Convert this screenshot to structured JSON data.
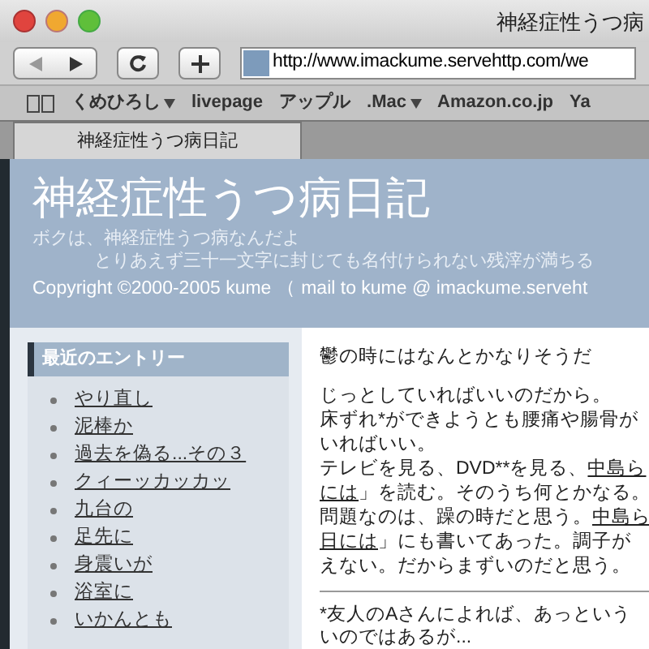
{
  "window": {
    "title": "神経症性うつ病"
  },
  "toolbar": {
    "url": "http://www.imackume.servehttp.com/we"
  },
  "bookmarks": [
    {
      "label": "くめひろし",
      "has_menu": true
    },
    {
      "label": "livepage",
      "has_menu": false
    },
    {
      "label": "アップル",
      "has_menu": false
    },
    {
      "label": ".Mac",
      "has_menu": true
    },
    {
      "label": "Amazon.co.jp",
      "has_menu": false
    },
    {
      "label": "Ya",
      "has_menu": false
    }
  ],
  "tabs": [
    {
      "label": "神経症性うつ病日記",
      "selected": true
    }
  ],
  "header": {
    "title": "神経症性うつ病日記",
    "tagline": [
      "ボクは、神経症性うつ病なんだよ",
      "とりあえず三十一文字に封じても名付けられない残滓が満ちる"
    ],
    "copyright": "Copyright ©2000-2005 kume （ mail to kume @ imackume.serveht"
  },
  "sidebar": {
    "heading": "最近のエントリー",
    "entries": [
      "やり直し",
      "泥棒か",
      "過去を偽る...その３",
      "クィーッカッカッ",
      "九台の",
      "足先に",
      "身震いが",
      "浴室に",
      "いかんとも"
    ]
  },
  "article": {
    "heading": "鬱の時にはなんとかなりそうだ",
    "lines": [
      [
        {
          "text": "じっとしていればいいのだから。",
          "link": false
        }
      ],
      [
        {
          "text": "床ずれ*ができようとも腰痛や腸骨が",
          "link": false
        }
      ],
      [
        {
          "text": "いればいい。",
          "link": false
        }
      ],
      [
        {
          "text": "テレビを見る、DVD**を見る、",
          "link": false
        },
        {
          "text": "中島ら",
          "link": true
        }
      ],
      [
        {
          "text": "には",
          "link": true
        },
        {
          "text": "」を読む。そのうち何とかなる。",
          "link": false
        }
      ],
      [
        {
          "text": "問題なのは、躁の時だと思う。",
          "link": false
        },
        {
          "text": "中島ら",
          "link": true
        }
      ],
      [
        {
          "text": "日には",
          "link": true
        },
        {
          "text": "」にも書いてあった。調子が",
          "link": false
        }
      ],
      [
        {
          "text": "えない。だからまずいのだと思う。",
          "link": false
        }
      ]
    ],
    "footnote": [
      "*友人のAさんによれば、あっという",
      "いのではあるが..."
    ]
  }
}
